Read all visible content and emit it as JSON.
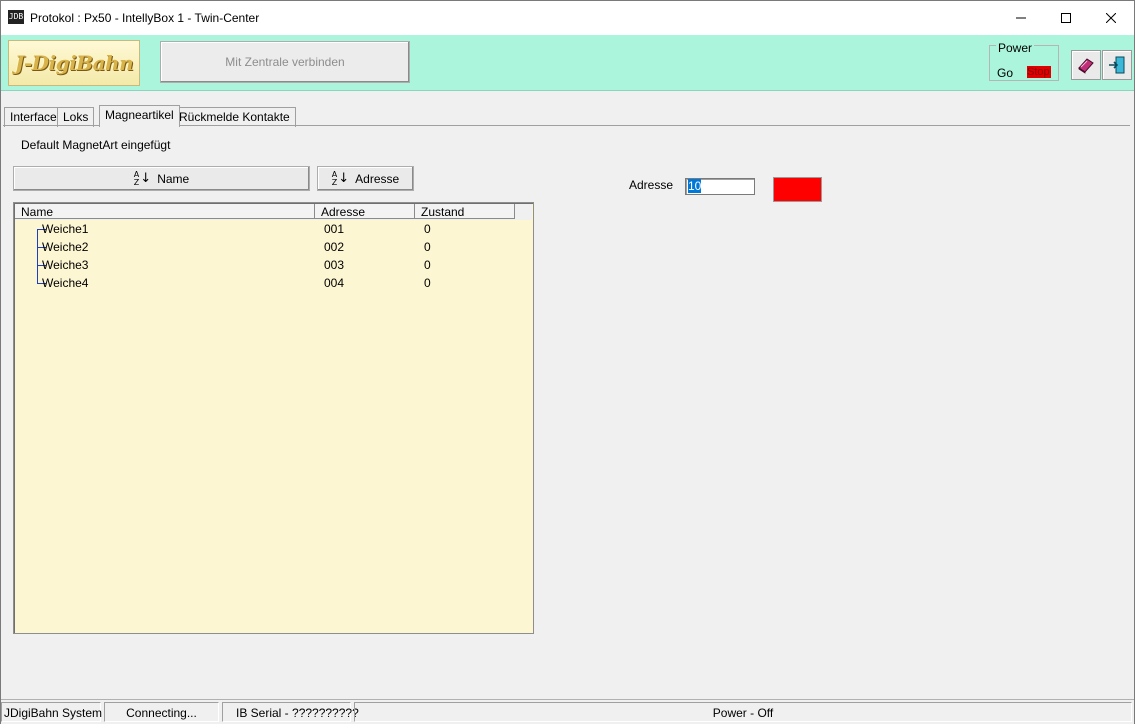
{
  "window": {
    "title": "Protokol : Px50 - IntellyBox 1 - Twin-Center",
    "app_icon_text": "JDB"
  },
  "toolbar": {
    "logo_text": "J-DigiBahn",
    "connect_label": "Mit Zentrale verbinden",
    "power": {
      "legend": "Power",
      "go": "Go",
      "stop": "Stop"
    }
  },
  "tabs": [
    {
      "label": "Interface",
      "active": false
    },
    {
      "label": "Loks",
      "active": false
    },
    {
      "label": "Magneartikel",
      "active": true
    },
    {
      "label": "Rückmelde Kontakte",
      "active": false
    }
  ],
  "panel": {
    "info": "Default MagnetArt eingefügt",
    "sort_name": "Name",
    "sort_address": "Adresse",
    "columns": [
      "Name",
      "Adresse",
      "Zustand"
    ],
    "rows": [
      {
        "name": "Weiche1",
        "address": "001",
        "state": "0"
      },
      {
        "name": "Weiche2",
        "address": "002",
        "state": "0"
      },
      {
        "name": "Weiche3",
        "address": "003",
        "state": "0"
      },
      {
        "name": "Weiche4",
        "address": "004",
        "state": "0"
      }
    ],
    "address_label": "Adresse",
    "address_value": "10",
    "state_color": "#ff0000"
  },
  "statusbar": {
    "system": "JDigiBahn System",
    "connection": "Connecting...",
    "serial": "IB Serial - ??????????",
    "power": "Power - Off"
  }
}
